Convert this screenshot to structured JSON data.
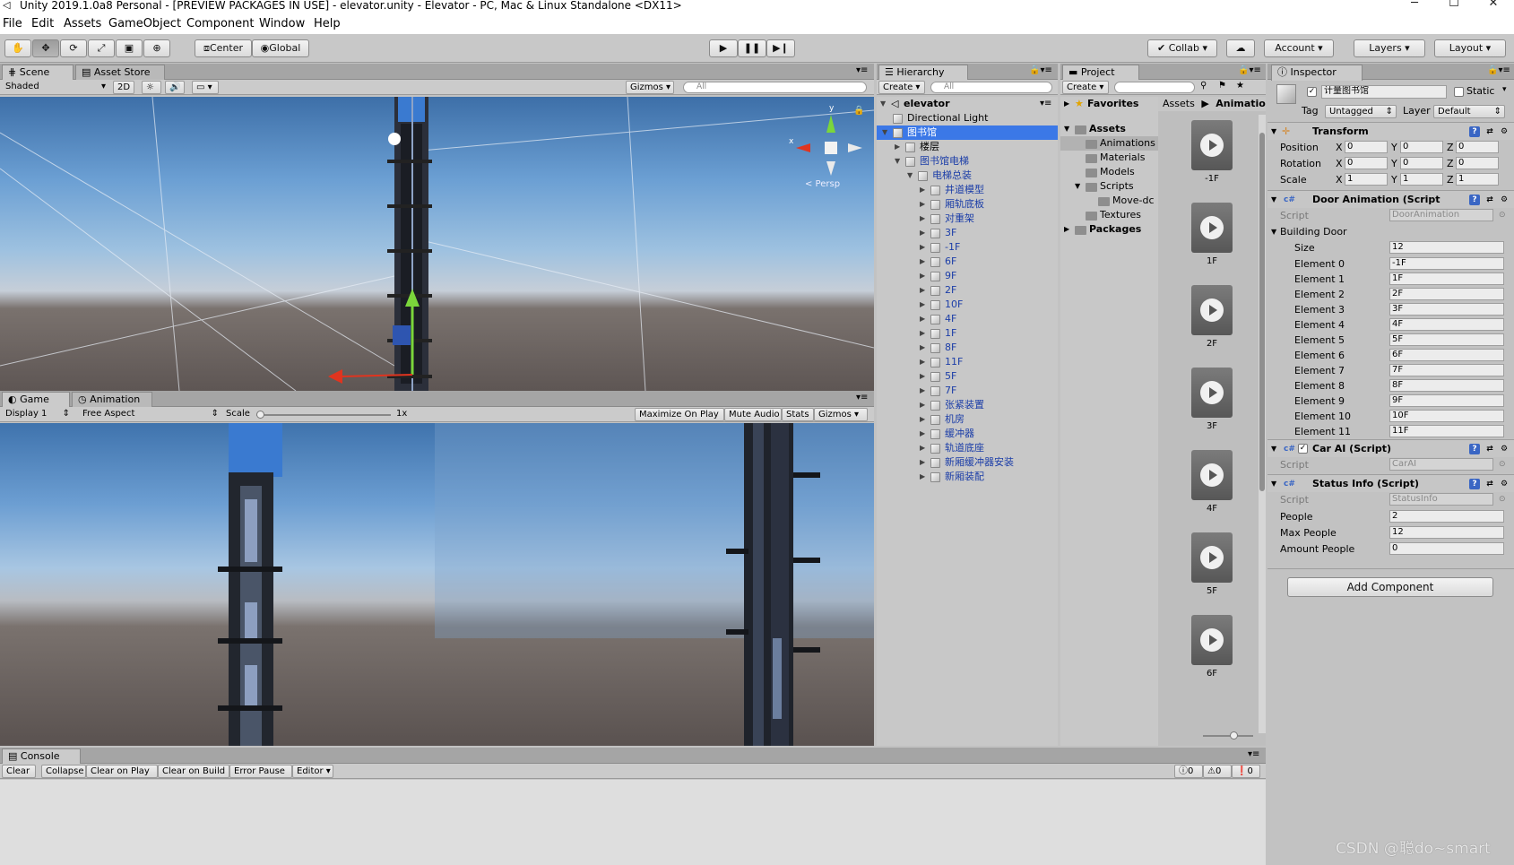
{
  "window": {
    "title": "Unity 2019.1.0a8 Personal - [PREVIEW PACKAGES IN USE] - elevator.unity - Elevator - PC, Mac & Linux Standalone <DX11>",
    "minimize": "─",
    "maximize": "☐",
    "close": "✕"
  },
  "menu": [
    "File",
    "Edit",
    "Assets",
    "GameObject",
    "Component",
    "Window",
    "Help"
  ],
  "toolbar": {
    "pivot": "Center",
    "space": "Global",
    "collab": "Collab ▾",
    "account": "Account",
    "layers": "Layers",
    "layout": "Layout"
  },
  "scene": {
    "tabs": [
      "Scene",
      "Asset Store"
    ],
    "shading": "Shaded",
    "mode2d": "2D",
    "gizmos": "Gizmos",
    "search_placeholder": "All",
    "gizmo_x": "x",
    "gizmo_y": "y",
    "persp": "< Persp"
  },
  "game": {
    "tabs": [
      "Game",
      "Animation"
    ],
    "display": "Display 1",
    "aspect": "Free Aspect",
    "scale_label": "Scale",
    "scale_value": "1x",
    "maximize": "Maximize On Play",
    "mute": "Mute Audio",
    "stats": "Stats",
    "gizmos": "Gizmos"
  },
  "hierarchy": {
    "tab": "Hierarchy",
    "create": "Create",
    "search_placeholder": "All",
    "scene_name": "elevator",
    "items": [
      {
        "label": "Directional Light",
        "depth": 1,
        "arrow": "",
        "selected": false,
        "prefab": false
      },
      {
        "label": "图书馆",
        "depth": 1,
        "arrow": "▼",
        "selected": true,
        "prefab": true
      },
      {
        "label": "楼层",
        "depth": 2,
        "arrow": "▶",
        "selected": false,
        "prefab": false
      },
      {
        "label": "图书馆电梯",
        "depth": 2,
        "arrow": "▼",
        "selected": false,
        "prefab": true
      },
      {
        "label": "电梯总装",
        "depth": 3,
        "arrow": "▼",
        "selected": false,
        "prefab": true
      },
      {
        "label": "井道模型",
        "depth": 4,
        "arrow": "▶",
        "selected": false,
        "prefab": true
      },
      {
        "label": "厢轨底板",
        "depth": 4,
        "arrow": "▶",
        "selected": false,
        "prefab": true
      },
      {
        "label": "对重架",
        "depth": 4,
        "arrow": "▶",
        "selected": false,
        "prefab": true
      },
      {
        "label": "3F",
        "depth": 4,
        "arrow": "▶",
        "selected": false,
        "prefab": true
      },
      {
        "label": "-1F",
        "depth": 4,
        "arrow": "▶",
        "selected": false,
        "prefab": true
      },
      {
        "label": "6F",
        "depth": 4,
        "arrow": "▶",
        "selected": false,
        "prefab": true
      },
      {
        "label": "9F",
        "depth": 4,
        "arrow": "▶",
        "selected": false,
        "prefab": true
      },
      {
        "label": "2F",
        "depth": 4,
        "arrow": "▶",
        "selected": false,
        "prefab": true
      },
      {
        "label": "10F",
        "depth": 4,
        "arrow": "▶",
        "selected": false,
        "prefab": true
      },
      {
        "label": "4F",
        "depth": 4,
        "arrow": "▶",
        "selected": false,
        "prefab": true
      },
      {
        "label": "1F",
        "depth": 4,
        "arrow": "▶",
        "selected": false,
        "prefab": true
      },
      {
        "label": "8F",
        "depth": 4,
        "arrow": "▶",
        "selected": false,
        "prefab": true
      },
      {
        "label": "11F",
        "depth": 4,
        "arrow": "▶",
        "selected": false,
        "prefab": true
      },
      {
        "label": "5F",
        "depth": 4,
        "arrow": "▶",
        "selected": false,
        "prefab": true
      },
      {
        "label": "7F",
        "depth": 4,
        "arrow": "▶",
        "selected": false,
        "prefab": true
      },
      {
        "label": "张紧装置",
        "depth": 4,
        "arrow": "▶",
        "selected": false,
        "prefab": true
      },
      {
        "label": "机房",
        "depth": 4,
        "arrow": "▶",
        "selected": false,
        "prefab": true
      },
      {
        "label": "缓冲器",
        "depth": 4,
        "arrow": "▶",
        "selected": false,
        "prefab": true
      },
      {
        "label": "轨道底座",
        "depth": 4,
        "arrow": "▶",
        "selected": false,
        "prefab": true
      },
      {
        "label": "新厢缓冲器安装",
        "depth": 4,
        "arrow": "▶",
        "selected": false,
        "prefab": true
      },
      {
        "label": "新厢装配",
        "depth": 4,
        "arrow": "▶",
        "selected": false,
        "prefab": true
      }
    ]
  },
  "project": {
    "tab": "Project",
    "create": "Create",
    "favorites": "Favorites",
    "assets": "Assets",
    "folders": [
      "Animations",
      "Materials",
      "Models",
      "Scripts",
      "Move-dc",
      "Textures"
    ],
    "packages": "Packages",
    "breadcrumb": [
      "Assets",
      "Animatio"
    ],
    "animations": [
      "-1F",
      "1F",
      "2F",
      "3F",
      "4F",
      "5F",
      "6F"
    ]
  },
  "inspector": {
    "tab": "Inspector",
    "object_name": "计量图书馆",
    "static_label": "Static",
    "tag_label": "Tag",
    "tag_value": "Untagged",
    "layer_label": "Layer",
    "layer_value": "Default",
    "transform": {
      "title": "Transform",
      "rows": [
        {
          "label": "Position",
          "x": "0",
          "y": "0",
          "z": "0"
        },
        {
          "label": "Rotation",
          "x": "0",
          "y": "0",
          "z": "0"
        },
        {
          "label": "Scale",
          "x": "1",
          "y": "1",
          "z": "1"
        }
      ]
    },
    "door_anim": {
      "title": "Door Animation (Script",
      "script_label": "Script",
      "script_value": "DoorAnimation",
      "array_label": "Building Door",
      "size_label": "Size",
      "size_value": "12",
      "elements": [
        {
          "label": "Element 0",
          "value": "-1F"
        },
        {
          "label": "Element 1",
          "value": "1F"
        },
        {
          "label": "Element 2",
          "value": "2F"
        },
        {
          "label": "Element 3",
          "value": "3F"
        },
        {
          "label": "Element 4",
          "value": "4F"
        },
        {
          "label": "Element 5",
          "value": "5F"
        },
        {
          "label": "Element 6",
          "value": "6F"
        },
        {
          "label": "Element 7",
          "value": "7F"
        },
        {
          "label": "Element 8",
          "value": "8F"
        },
        {
          "label": "Element 9",
          "value": "9F"
        },
        {
          "label": "Element 10",
          "value": "10F"
        },
        {
          "label": "Element 11",
          "value": "11F"
        }
      ]
    },
    "car_ai": {
      "title": "Car AI (Script)",
      "script_label": "Script",
      "script_value": "CarAI"
    },
    "status_info": {
      "title": "Status Info (Script)",
      "script_label": "Script",
      "script_value": "StatusInfo",
      "rows": [
        {
          "label": "People",
          "value": "2"
        },
        {
          "label": "Max People",
          "value": "12"
        },
        {
          "label": "Amount People",
          "value": "0"
        }
      ]
    },
    "add_component": "Add Component"
  },
  "console": {
    "tab": "Console",
    "buttons": [
      "Clear",
      "Collapse",
      "Clear on Play",
      "Clear on Build",
      "Error Pause",
      "Editor"
    ],
    "counts": {
      "info": "0",
      "warn": "0",
      "error": "0"
    }
  },
  "watermark": "CSDN @聪do~smart",
  "colors": {
    "selection": "#3b78e7",
    "prefab_text": "#1c3ea8",
    "tab_active": "#cbcbcb"
  }
}
